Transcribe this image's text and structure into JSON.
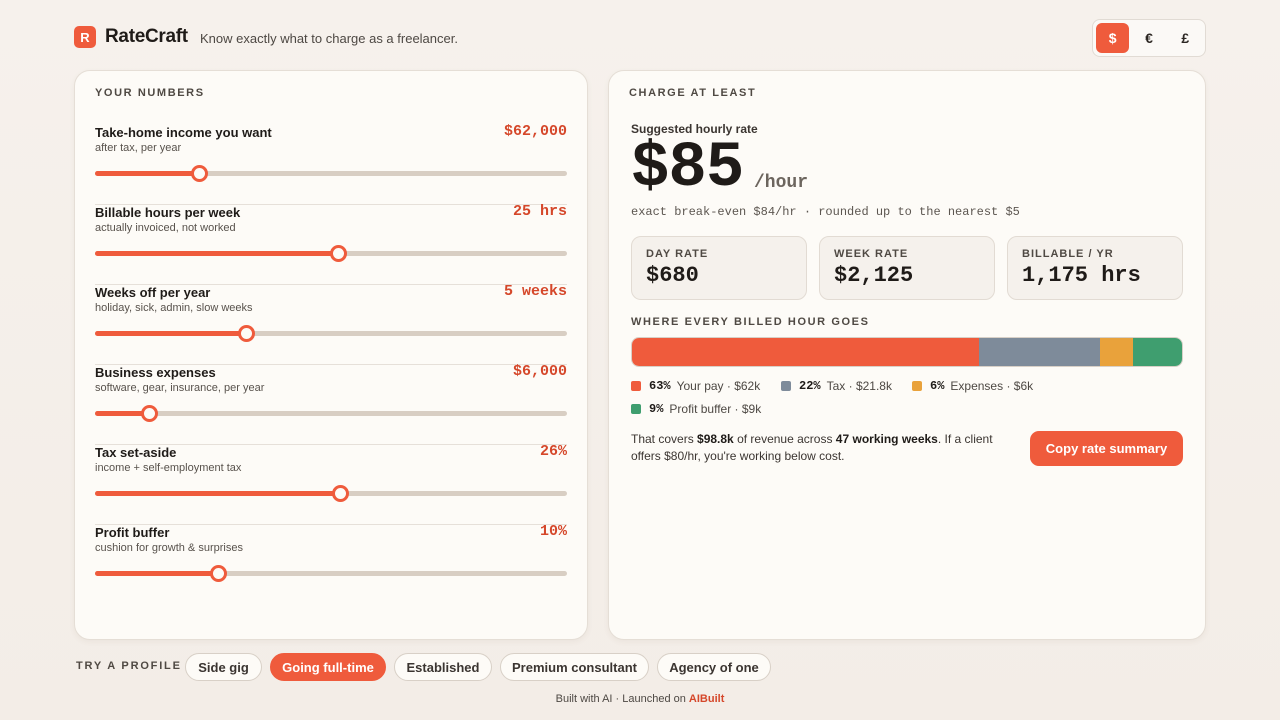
{
  "header": {
    "logo_letter": "R",
    "brand": "RateCraft",
    "tagline": "Know exactly what to charge as a freelancer.",
    "currencies": [
      "$",
      "€",
      "£"
    ],
    "active_currency": "$"
  },
  "inputs": {
    "title": "YOUR NUMBERS",
    "sliders": [
      {
        "label": "Take-home income you want",
        "sub": "after tax, per year",
        "value": "$62,000",
        "fraction": 0.22
      },
      {
        "label": "Billable hours per week",
        "sub": "actually invoiced, not worked",
        "value": "25 hrs",
        "fraction": 0.515
      },
      {
        "label": "Weeks off per year",
        "sub": "holiday, sick, admin, slow weeks",
        "value": "5 weeks",
        "fraction": 0.32
      },
      {
        "label": "Business expenses",
        "sub": "software, gear, insurance, per year",
        "value": "$6,000",
        "fraction": 0.115
      },
      {
        "label": "Tax set-aside",
        "sub": "income + self-employment tax",
        "value": "26%",
        "fraction": 0.52
      },
      {
        "label": "Profit buffer",
        "sub": "cushion for growth & surprises",
        "value": "10%",
        "fraction": 0.26
      }
    ]
  },
  "result": {
    "title": "CHARGE AT LEAST",
    "suggested_label": "Suggested hourly rate",
    "rate": "$85",
    "per_hour": "/hour",
    "exact_note": "exact break-even $84/hr · rounded up to the nearest $5",
    "stats": [
      {
        "label": "DAY RATE",
        "value": "$680"
      },
      {
        "label": "WEEK RATE",
        "value": "$2,125"
      },
      {
        "label": "BILLABLE / YR",
        "value": "1,175 hrs"
      }
    ],
    "breakdown_title": "WHERE EVERY BILLED HOUR GOES",
    "breakdown": [
      {
        "pct": "63%",
        "label": "Your pay · $62k",
        "share": 63,
        "color": "#ef5b3c"
      },
      {
        "pct": "22%",
        "label": "Tax · $21.8k",
        "share": 22,
        "color": "#7e8b9a"
      },
      {
        "pct": "6%",
        "label": "Expenses · $6k",
        "share": 6,
        "color": "#e9a23b"
      },
      {
        "pct": "9%",
        "label": "Profit buffer · $9k",
        "share": 9,
        "color": "#3f9e6f"
      }
    ],
    "covers": {
      "t1": "That covers ",
      "revenue": "$98.8k",
      "t2": " of revenue across ",
      "weeks": "47 working weeks",
      "t3": ". If a client offers $80/hr, you're working below cost."
    },
    "copy_button": "Copy rate summary"
  },
  "profiles": {
    "label": "TRY A PROFILE",
    "items": [
      "Side gig",
      "Going full-time",
      "Established",
      "Premium consultant",
      "Agency of one"
    ],
    "active": "Going full-time"
  },
  "footer": {
    "text": "Built with AI · Launched on ",
    "link": "AIBuilt"
  }
}
